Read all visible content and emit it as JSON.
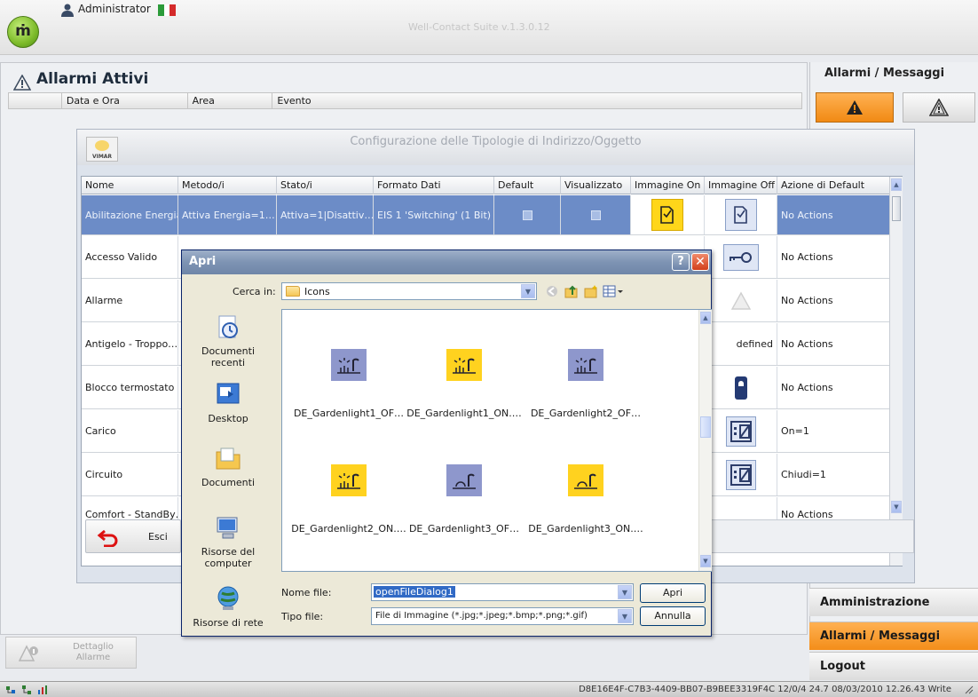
{
  "app": {
    "user": "Administrator",
    "title": "Well-Contact Suite v.1.3.0.12"
  },
  "alarms_panel": {
    "title": "Allarmi Attivi",
    "columns": [
      "Data e Ora",
      "Area",
      "Evento"
    ]
  },
  "right_panel": {
    "title": "Allarmi / Messaggi",
    "nav": {
      "admin": "Amministrazione",
      "alarms": "Allarmi / Messaggi",
      "logout": "Logout"
    }
  },
  "detail_button": {
    "label": "Dettaglio Allarme"
  },
  "status_bar": {
    "text": "D8E16E4F-C7B3-4409-BB07-B9BEE3319F4C 12/0/4 24.7 08/03/2010 12.26.43 Write"
  },
  "config_window": {
    "title": "Configurazione delle Tipologie di Indirizzo/Oggetto",
    "logo_text": "VIMAR",
    "columns": [
      "Nome",
      "Metodo/i",
      "Stato/i",
      "Formato Dati",
      "Default",
      "Visualizzato",
      "Immagine On",
      "Immagine Off",
      "Azione di Default"
    ],
    "rows": [
      {
        "nome": "Abilitazione Energia",
        "metodo": "Attiva Energia=1…",
        "stato": "Attiva=1|Disattiv…",
        "formato": "EIS 1 'Switching' (1 Bit)",
        "azione": "No Actions"
      },
      {
        "nome": "Accesso Valido",
        "azione": "No Actions"
      },
      {
        "nome": "Allarme",
        "azione": "No Actions"
      },
      {
        "nome": "Antigelo - Troppo…",
        "img_off_text": "defined",
        "azione": "No Actions"
      },
      {
        "nome": "Blocco termostato",
        "azione": "No Actions"
      },
      {
        "nome": "Carico",
        "azione": "On=1"
      },
      {
        "nome": "Circuito",
        "azione": "Chiudi=1"
      },
      {
        "nome": "Comfort - StandBy…",
        "azione": "No Actions"
      }
    ],
    "exit_label": "Esci"
  },
  "open_dialog": {
    "title": "Apri",
    "look_in_label": "Cerca in:",
    "look_in_value": "Icons",
    "places": [
      "Documenti recenti",
      "Desktop",
      "Documenti",
      "Risorse del computer",
      "Risorse di rete"
    ],
    "files": [
      {
        "name": "DE_Gardenlight1_OF…",
        "state": "off"
      },
      {
        "name": "DE_Gardenlight1_ON.…",
        "state": "on"
      },
      {
        "name": "DE_Gardenlight2_OF…",
        "state": "off"
      },
      {
        "name": "DE_Gardenlight2_ON.…",
        "state": "on"
      },
      {
        "name": "DE_Gardenlight3_OF…",
        "state": "off"
      },
      {
        "name": "DE_Gardenlight3_ON.…",
        "state": "on"
      }
    ],
    "file_name_label": "Nome file:",
    "file_name_value": "openFileDialog1",
    "file_type_label": "Tipo file:",
    "file_type_value": "File di Immagine (*.jpg;*.jpeg;*.bmp;*.png;*.gif)",
    "open_button": "Apri",
    "cancel_button": "Annulla"
  },
  "colors": {
    "accent_orange": "#f18a14",
    "selected_row": "#6c8cc7",
    "dialog_titlebar": "#7d93b3"
  }
}
